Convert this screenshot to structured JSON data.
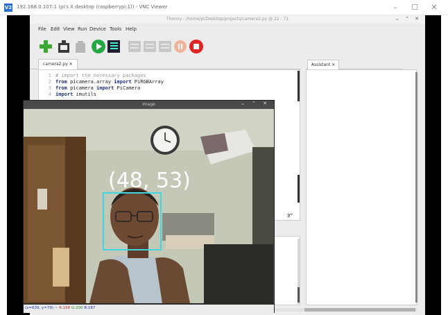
{
  "vnc": {
    "title": "192.168.0.107:1 (pi's X desktop (raspberrypi:1)) - VNC Viewer",
    "logo": "V2",
    "minimize": "–",
    "maximize": "☐",
    "close": "✕"
  },
  "thonny": {
    "title": "Thonny - /home/pi/Desktop/projects/camera2.py @ 22 : 71",
    "window_controls": "⌄ ⌃ ✕",
    "menu": [
      "File",
      "Edit",
      "View",
      "Run",
      "Device",
      "Tools",
      "Help"
    ],
    "toolbar_icons": [
      "new-file-icon",
      "load-icon",
      "save-icon",
      "run-icon",
      "debug-icon",
      "step-over-icon",
      "step-into-icon",
      "step-out-icon",
      "resume-icon",
      "stop-icon"
    ],
    "tab_label": "camera2.py ✕",
    "code": [
      {
        "n": "1",
        "parts": [
          {
            "c": "cm",
            "t": "# import the necessary packages"
          }
        ]
      },
      {
        "n": "2",
        "parts": [
          {
            "c": "kw",
            "t": "from"
          },
          {
            "c": "tx",
            "t": " picamera.array "
          },
          {
            "c": "kw",
            "t": "import"
          },
          {
            "c": "tx",
            "t": " PiRGBArray"
          }
        ]
      },
      {
        "n": "3",
        "parts": [
          {
            "c": "kw",
            "t": "from"
          },
          {
            "c": "tx",
            "t": " picamera "
          },
          {
            "c": "kw",
            "t": "import"
          },
          {
            "c": "tx",
            "t": " PiCamera"
          }
        ]
      },
      {
        "n": "4",
        "parts": [
          {
            "c": "kw",
            "t": "import"
          },
          {
            "c": "tx",
            "t": " imutils"
          }
        ]
      }
    ],
    "code_fragment": "3\"",
    "assistant_label": "Assistant ✕"
  },
  "image_window": {
    "title": "image",
    "controls": "⌄ ⌃ ✕",
    "overlay_text": "(48, 53)",
    "status": {
      "prefix": "(x=639, y=79) ~ ",
      "r": "R:168",
      "g": "G:200",
      "b": "B:187"
    },
    "box_color": "#3fd6e0"
  }
}
